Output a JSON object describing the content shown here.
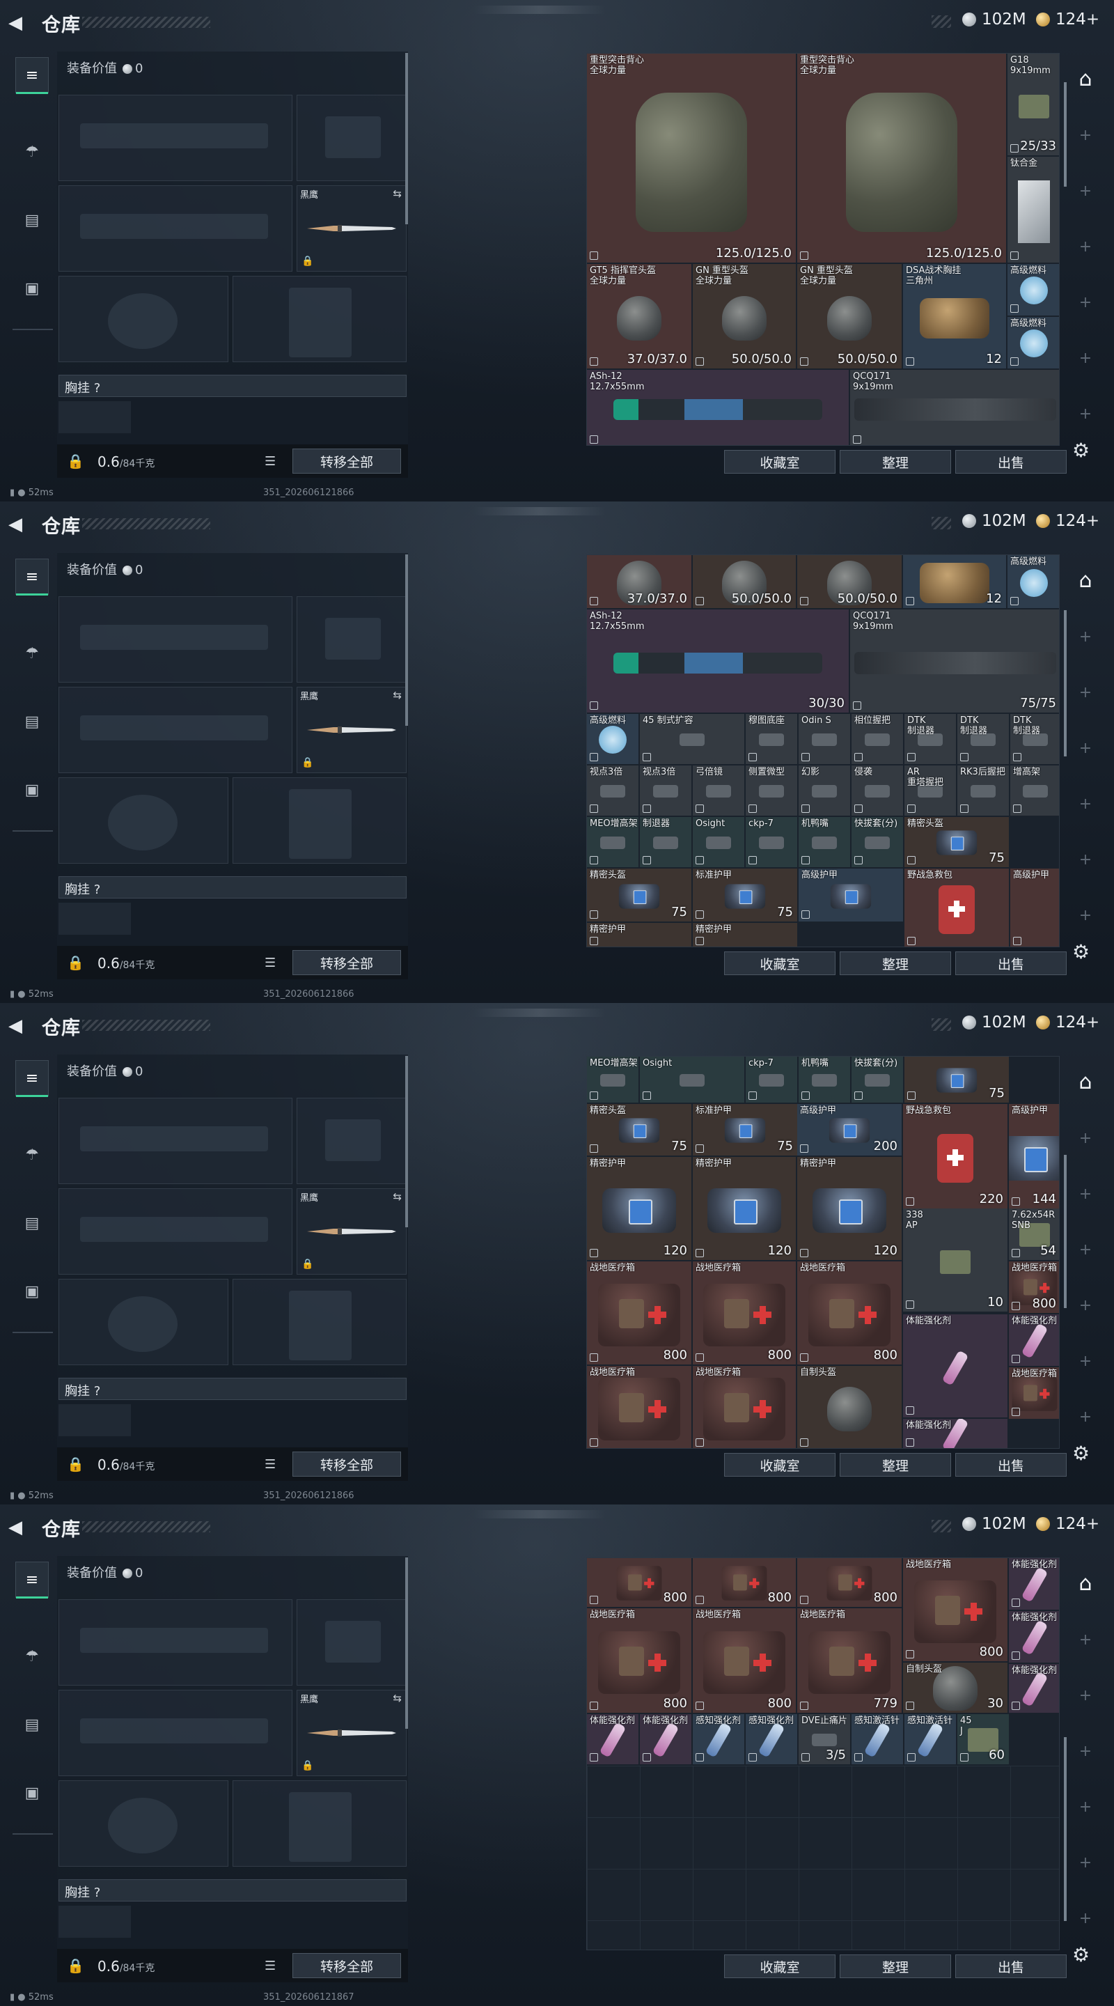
{
  "header": {
    "title": "仓库",
    "back_icon": "back-arrow-icon",
    "currency_silver": "102M",
    "currency_gold": "124+"
  },
  "leftnav": {
    "items": [
      "weapon-tab-icon",
      "gear-tab-icon",
      "clipboard-tab-icon",
      "case-tab-icon"
    ]
  },
  "loadout": {
    "equip_value_label": "装备价值",
    "equip_value": "0",
    "knife_slot_name": "黑鹰",
    "chest_rig_label": "胸挂",
    "chest_rig_hint": "?",
    "weight_value": "0.6",
    "weight_max": "/84千克",
    "transfer_all": "转移全部"
  },
  "actions": {
    "collection": "收藏室",
    "sort": "整理",
    "sell": "出售"
  },
  "status": {
    "ping": "52ms",
    "version_a": "351_202606121866",
    "version_b": "351_202606121867"
  },
  "frames": [
    {
      "cells": [
        {
          "n": "重型突击背心\n全球力量",
          "v": "125.0/125.0",
          "cls": "c-red",
          "pic": "vest"
        },
        {
          "n": "重型突击背心\n全球力量",
          "v": "125.0/125.0",
          "cls": "c-red",
          "pic": "vest"
        },
        {
          "n": "G18\n9x19mm",
          "v": "25/33",
          "cls": "c-gray",
          "pic": "ammo"
        },
        {
          "n": "钛合金",
          "v": "",
          "cls": "c-gray",
          "pic": "metal"
        },
        {
          "n": "GT5 指挥官头盔\n全球力量",
          "v": "37.0/37.0",
          "cls": "c-red",
          "pic": "helmet"
        },
        {
          "n": "GN 重型头盔\n全球力量",
          "v": "50.0/50.0",
          "cls": "c-brown",
          "pic": "helmet"
        },
        {
          "n": "GN 重型头盔\n全球力量",
          "v": "50.0/50.0",
          "cls": "c-brown",
          "pic": "helmet"
        },
        {
          "n": "DSA战术胸挂\n三角州",
          "v": "12",
          "cls": "c-blue",
          "pic": "bag"
        },
        {
          "n": "高级燃料",
          "v": "",
          "cls": "c-blue",
          "pic": "can"
        },
        {
          "n": "高级燃料",
          "v": "",
          "cls": "c-blue",
          "pic": "can"
        },
        {
          "n": "ASh-12\n12.7x55mm",
          "v": "",
          "cls": "c-purple",
          "pic": "gun"
        },
        {
          "n": "QCQ171\n9x19mm",
          "v": "",
          "cls": "c-gray",
          "pic": "gun2"
        }
      ]
    },
    {
      "cells": [
        {
          "n": "",
          "v": "37.0/37.0",
          "cls": "c-red",
          "pic": "helmet"
        },
        {
          "n": "",
          "v": "50.0/50.0",
          "cls": "c-brown",
          "pic": "helmet"
        },
        {
          "n": "",
          "v": "50.0/50.0",
          "cls": "c-brown",
          "pic": "helmet"
        },
        {
          "n": "",
          "v": "12",
          "cls": "c-blue",
          "pic": "bag"
        },
        {
          "n": "高级燃料",
          "v": "",
          "cls": "c-blue",
          "pic": "can"
        },
        {
          "n": "ASh-12\n12.7x55mm",
          "v": "30/30",
          "cls": "c-purple",
          "pic": "gun"
        },
        {
          "n": "QCQ171\n9x19mm",
          "v": "75/75",
          "cls": "c-gray",
          "pic": "gun2"
        },
        {
          "n": "高级燃料",
          "v": "",
          "cls": "c-blue",
          "pic": "can"
        },
        {
          "n": "45 制式扩容",
          "v": "",
          "cls": "c-gray",
          "pic": "smallpart"
        },
        {
          "n": "穆图底座",
          "v": "",
          "cls": "c-gray",
          "pic": "smallpart"
        },
        {
          "n": "Odin S",
          "v": "",
          "cls": "c-gray",
          "pic": "smallpart"
        },
        {
          "n": "相位握把",
          "v": "",
          "cls": "c-gray",
          "pic": "smallpart"
        },
        {
          "n": "DTK\n制退器",
          "v": "",
          "cls": "c-gray",
          "pic": "smallpart"
        },
        {
          "n": "DTK\n制退器",
          "v": "",
          "cls": "c-gray",
          "pic": "smallpart"
        },
        {
          "n": "DTK\n制退器",
          "v": "",
          "cls": "c-gray",
          "pic": "smallpart"
        },
        {
          "n": "视点3倍",
          "v": "",
          "cls": "c-gray",
          "pic": "smallpart"
        },
        {
          "n": "视点3倍",
          "v": "",
          "cls": "c-gray",
          "pic": "smallpart"
        },
        {
          "n": "弓倍镜",
          "v": "",
          "cls": "c-gray",
          "pic": "smallpart"
        },
        {
          "n": "侧置微型",
          "v": "",
          "cls": "c-gray",
          "pic": "smallpart"
        },
        {
          "n": "幻影",
          "v": "",
          "cls": "c-gray",
          "pic": "smallpart"
        },
        {
          "n": "侵袭",
          "v": "",
          "cls": "c-gray",
          "pic": "smallpart"
        },
        {
          "n": "AR\n重塔握把",
          "v": "",
          "cls": "c-gray",
          "pic": "smallpart"
        },
        {
          "n": "RK3后握把",
          "v": "",
          "cls": "c-gray",
          "pic": "smallpart"
        },
        {
          "n": "增高架",
          "v": "",
          "cls": "c-gray",
          "pic": "smallpart"
        },
        {
          "n": "MEO增高架",
          "v": "",
          "cls": "c-teal",
          "pic": "smallpart"
        },
        {
          "n": "制退器",
          "v": "",
          "cls": "c-teal",
          "pic": "smallpart"
        },
        {
          "n": "Osight",
          "v": "",
          "cls": "c-teal",
          "pic": "smallpart"
        },
        {
          "n": "ckp-7",
          "v": "",
          "cls": "c-teal",
          "pic": "smallpart"
        },
        {
          "n": "机鸭嘴",
          "v": "",
          "cls": "c-teal",
          "pic": "smallpart"
        },
        {
          "n": "快拔套(分)",
          "v": "",
          "cls": "c-teal",
          "pic": "smallpart"
        },
        {
          "n": "精密头盔",
          "v": "75",
          "cls": "c-brown",
          "pic": "armbag"
        },
        {
          "n": "精密头盔",
          "v": "75",
          "cls": "c-brown",
          "pic": "armbag"
        },
        {
          "n": "标准护甲",
          "v": "75",
          "cls": "c-brown",
          "pic": "armbag"
        },
        {
          "n": "高级护甲",
          "v": "",
          "cls": "c-blue",
          "pic": "armbag"
        },
        {
          "n": "野战急救包",
          "v": "",
          "cls": "c-red",
          "pic": "medkit2"
        },
        {
          "n": "高级护甲",
          "v": "",
          "cls": "c-red",
          "pic": ""
        },
        {
          "n": "精密护甲",
          "v": "",
          "cls": "c-brown",
          "pic": ""
        },
        {
          "n": "精密护甲",
          "v": "",
          "cls": "c-brown",
          "pic": ""
        }
      ]
    },
    {
      "cells": [
        {
          "n": "MEO增高架 制退器",
          "v": "",
          "cls": "c-teal",
          "pic": "smallpart"
        },
        {
          "n": "Osight",
          "v": "",
          "cls": "c-teal",
          "pic": "smallpart"
        },
        {
          "n": "ckp-7",
          "v": "",
          "cls": "c-teal",
          "pic": "smallpart"
        },
        {
          "n": "机鸭嘴",
          "v": "",
          "cls": "c-teal",
          "pic": "smallpart"
        },
        {
          "n": "快拔套(分)",
          "v": "",
          "cls": "c-teal",
          "pic": "smallpart"
        },
        {
          "n": "",
          "v": "75",
          "cls": "c-brown",
          "pic": "armbag"
        },
        {
          "n": "精密头盔",
          "v": "75",
          "cls": "c-brown",
          "pic": "armbag"
        },
        {
          "n": "标准护甲",
          "v": "75",
          "cls": "c-brown",
          "pic": "armbag"
        },
        {
          "n": "高级护甲",
          "v": "200",
          "cls": "c-blue",
          "pic": "armbag"
        },
        {
          "n": "野战急救包",
          "v": "220",
          "cls": "c-red",
          "pic": "medkit2"
        },
        {
          "n": "高级护甲",
          "v": "144",
          "cls": "c-red",
          "pic": "armbag"
        },
        {
          "n": "精密护甲",
          "v": "120",
          "cls": "c-brown",
          "pic": "armbag"
        },
        {
          "n": "精密护甲",
          "v": "120",
          "cls": "c-brown",
          "pic": "armbag"
        },
        {
          "n": "精密护甲",
          "v": "120",
          "cls": "c-brown",
          "pic": "armbag"
        },
        {
          "n": "338\nAP",
          "v": "10",
          "cls": "c-gray",
          "pic": "ammo"
        },
        {
          "n": "7.62x54R\nSNB",
          "v": "54",
          "cls": "c-gray",
          "pic": "ammo"
        },
        {
          "n": "战地医疗箱",
          "v": "800",
          "cls": "c-red",
          "pic": "case"
        },
        {
          "n": "战地医疗箱",
          "v": "800",
          "cls": "c-red",
          "pic": "case"
        },
        {
          "n": "战地医疗箱",
          "v": "800",
          "cls": "c-red",
          "pic": "case"
        },
        {
          "n": "战地医疗箱",
          "v": "800",
          "cls": "c-red",
          "pic": "case"
        },
        {
          "n": "体能强化剂",
          "v": "",
          "cls": "c-purple",
          "pic": "syr"
        },
        {
          "n": "体能强化剂",
          "v": "",
          "cls": "c-purple",
          "pic": "syr"
        },
        {
          "n": "战地医疗箱",
          "v": "",
          "cls": "c-red",
          "pic": "case"
        },
        {
          "n": "战地医疗箱",
          "v": "",
          "cls": "c-red",
          "pic": "case"
        },
        {
          "n": "战地医疗箱",
          "v": "",
          "cls": "c-red",
          "pic": "case"
        },
        {
          "n": "自制头盔",
          "v": "",
          "cls": "c-brown",
          "pic": "helmet"
        },
        {
          "n": "体能强化剂",
          "v": "",
          "cls": "c-purple",
          "pic": "syr"
        }
      ]
    },
    {
      "cells": [
        {
          "n": "",
          "v": "800",
          "cls": "c-red",
          "pic": "case"
        },
        {
          "n": "",
          "v": "800",
          "cls": "c-red",
          "pic": "case"
        },
        {
          "n": "",
          "v": "800",
          "cls": "c-red",
          "pic": "case"
        },
        {
          "n": "战地医疗箱",
          "v": "800",
          "cls": "c-red",
          "pic": "case"
        },
        {
          "n": "体能强化剂",
          "v": "",
          "cls": "c-purple",
          "pic": "syr"
        },
        {
          "n": "体能强化剂",
          "v": "",
          "cls": "c-purple",
          "pic": "syr"
        },
        {
          "n": "战地医疗箱",
          "v": "800",
          "cls": "c-red",
          "pic": "case"
        },
        {
          "n": "战地医疗箱",
          "v": "800",
          "cls": "c-red",
          "pic": "case"
        },
        {
          "n": "战地医疗箱",
          "v": "779",
          "cls": "c-red",
          "pic": "case"
        },
        {
          "n": "自制头盔",
          "v": "30",
          "cls": "c-brown",
          "pic": "helmet"
        },
        {
          "n": "体能强化剂",
          "v": "",
          "cls": "c-purple",
          "pic": "syr"
        },
        {
          "n": "体能强化剂",
          "v": "",
          "cls": "c-purple",
          "pic": "syr"
        },
        {
          "n": "体能强化剂",
          "v": "",
          "cls": "c-purple",
          "pic": "syr"
        },
        {
          "n": "感知强化剂",
          "v": "",
          "cls": "c-blue",
          "pic": "syrb"
        },
        {
          "n": "感知强化剂",
          "v": "",
          "cls": "c-blue",
          "pic": "syrb"
        },
        {
          "n": "DVE止痛片",
          "v": "3/5",
          "cls": "c-gray",
          "pic": "smallpart"
        },
        {
          "n": "感知激活针",
          "v": "",
          "cls": "c-blue",
          "pic": "syrb"
        },
        {
          "n": "感知激活针",
          "v": "",
          "cls": "c-blue",
          "pic": "syrb"
        },
        {
          "n": "45\nJ",
          "v": "60",
          "cls": "c-teal",
          "pic": "ammo"
        }
      ]
    }
  ]
}
